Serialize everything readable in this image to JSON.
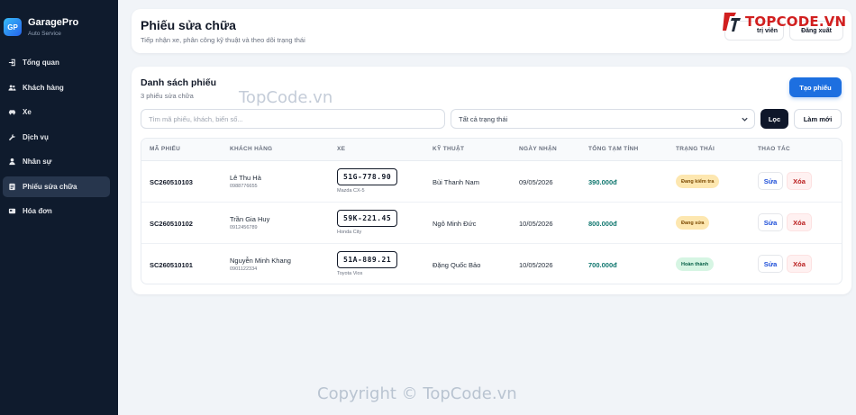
{
  "brand": {
    "logo": "GP",
    "name": "GaragePro",
    "subtitle": "Auto Service"
  },
  "sidebar": {
    "items": [
      {
        "label": "Tổng quan",
        "icon": "login-icon",
        "active": false
      },
      {
        "label": "Khách hàng",
        "icon": "users-icon",
        "active": false
      },
      {
        "label": "Xe",
        "icon": "car-icon",
        "active": false
      },
      {
        "label": "Dịch vụ",
        "icon": "wrench-icon",
        "active": false
      },
      {
        "label": "Nhân sự",
        "icon": "user-icon",
        "active": false
      },
      {
        "label": "Phiếu sửa chữa",
        "icon": "ticket-icon",
        "active": true
      },
      {
        "label": "Hóa đơn",
        "icon": "invoice-icon",
        "active": false
      }
    ]
  },
  "header": {
    "title": "Phiếu sửa chữa",
    "subtitle": "Tiếp nhận xe, phân công kỹ thuật và theo dõi trạng thái",
    "admin_label": "trị viên",
    "logout_label": "Đăng xuất"
  },
  "list": {
    "title": "Danh sách phiếu",
    "count": "3 phiếu sửa chữa",
    "create_label": "Tạo phiếu",
    "search_placeholder": "Tìm mã phiếu, khách, biển số...",
    "status_value": "Tất cả trạng thái",
    "filter_label": "Lọc",
    "reset_label": "Làm mới",
    "columns": [
      "MÃ PHIẾU",
      "KHÁCH HÀNG",
      "XE",
      "KỸ THUẬT",
      "NGÀY NHẬN",
      "TỔNG TẠM TÍNH",
      "TRẠNG THÁI",
      "THAO TÁC"
    ],
    "rows": [
      {
        "code": "SC260510103",
        "customer": "Lê Thu Hà",
        "phone": "0988776655",
        "plate": "51G-778.90",
        "car": "Mazda CX-5",
        "tech": "Bùi Thanh Nam",
        "date": "09/05/2026",
        "total": "390.000đ",
        "status": "Đang kiểm tra",
        "status_type": "warn",
        "edit": "Sửa",
        "delete": "Xóa"
      },
      {
        "code": "SC260510102",
        "customer": "Trần Gia Huy",
        "phone": "0912456789",
        "plate": "59K-221.45",
        "car": "Honda City",
        "tech": "Ngô Minh Đức",
        "date": "10/05/2026",
        "total": "800.000đ",
        "status": "Đang sửa",
        "status_type": "warn",
        "edit": "Sửa",
        "delete": "Xóa"
      },
      {
        "code": "SC260510101",
        "customer": "Nguyễn Minh Khang",
        "phone": "0901122334",
        "plate": "51A-889.21",
        "car": "Toyota Vios",
        "tech": "Đặng Quốc Bảo",
        "date": "10/05/2026",
        "total": "700.000đ",
        "status": "Hoàn thành",
        "status_type": "ok",
        "edit": "Sửa",
        "delete": "Xóa"
      }
    ]
  },
  "watermarks": {
    "logo_text": "TOPCODE.VN",
    "center": "TopCode.vn",
    "bottom": "Copyright © TopCode.vn"
  },
  "colors": {
    "sidebar": "#0f1b2d",
    "accent": "#1d6fe0",
    "total": "#0f766e",
    "danger": "#b91c1c"
  }
}
